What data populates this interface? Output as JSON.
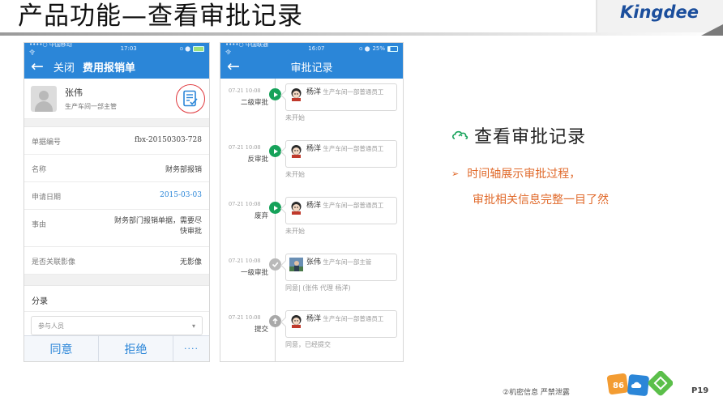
{
  "slide": {
    "title": "产品功能—查看审批记录",
    "brand": "Kingdee"
  },
  "left_phone": {
    "status": {
      "carrier": "••••○ 中国移动 令",
      "time": "17:03"
    },
    "nav": {
      "back": "←",
      "close": "关闭",
      "title": "费用报销单"
    },
    "profile": {
      "name": "张伟",
      "role": "生产车间一部主管"
    },
    "fields": [
      {
        "label": "单据编号",
        "value": "fbx-20150303-728"
      },
      {
        "label": "名称",
        "value": "财务部报销"
      },
      {
        "label": "申请日期",
        "value": "2015-03-03"
      },
      {
        "label": "事由",
        "value": "财务部门报销单据，需要尽快审批"
      },
      {
        "label": "是否关联影像",
        "value": "无影像"
      }
    ],
    "section": {
      "title": "分录",
      "participants_placeholder": "参与人员",
      "participants_caret": "▾"
    },
    "actions": {
      "agree": "同意",
      "reject": "拒绝",
      "more": "····"
    }
  },
  "right_phone": {
    "status": {
      "carrier": "••••○ 中国联通 令",
      "time": "16:07",
      "battery": "25%"
    },
    "nav": {
      "back": "←",
      "title": "审批记录"
    },
    "entries": [
      {
        "time": "07-21 10:08",
        "step": "二级审批",
        "node": "play",
        "name": "杨洋",
        "role": "生产车间一部普通员工",
        "status": "未开始"
      },
      {
        "time": "07-21 10:08",
        "step": "反审批",
        "node": "play",
        "name": "杨洋",
        "role": "生产车间一部普通员工",
        "status": "未开始"
      },
      {
        "time": "07-21 10:08",
        "step": "废弃",
        "node": "play",
        "name": "杨洋",
        "role": "生产车间一部普通员工",
        "status": "未开始"
      },
      {
        "time": "07-21 10:08",
        "step": "一级审批",
        "node": "done",
        "name": "张伟",
        "role": "生产车间一部主管",
        "status": "同意| (张伟 代理 杨洋)"
      },
      {
        "time": "07-21 10:08",
        "step": "提交",
        "node": "up",
        "name": "杨洋",
        "role": "生产车间一部普通员工",
        "status": "同意，已经提交"
      }
    ]
  },
  "feature": {
    "heading": "查看审批记录",
    "bullet_line1": "时间轴展示审批过程，",
    "bullet_line2": "审批相关信息完整一目了然"
  },
  "footer": {
    "note": "②机密信息 严禁泄露",
    "page": "P19"
  },
  "colors": {
    "primary_blue": "#2b86d8",
    "accent_orange": "#e0692a",
    "node_green": "#16a25a",
    "highlight_red": "#e0393e"
  }
}
